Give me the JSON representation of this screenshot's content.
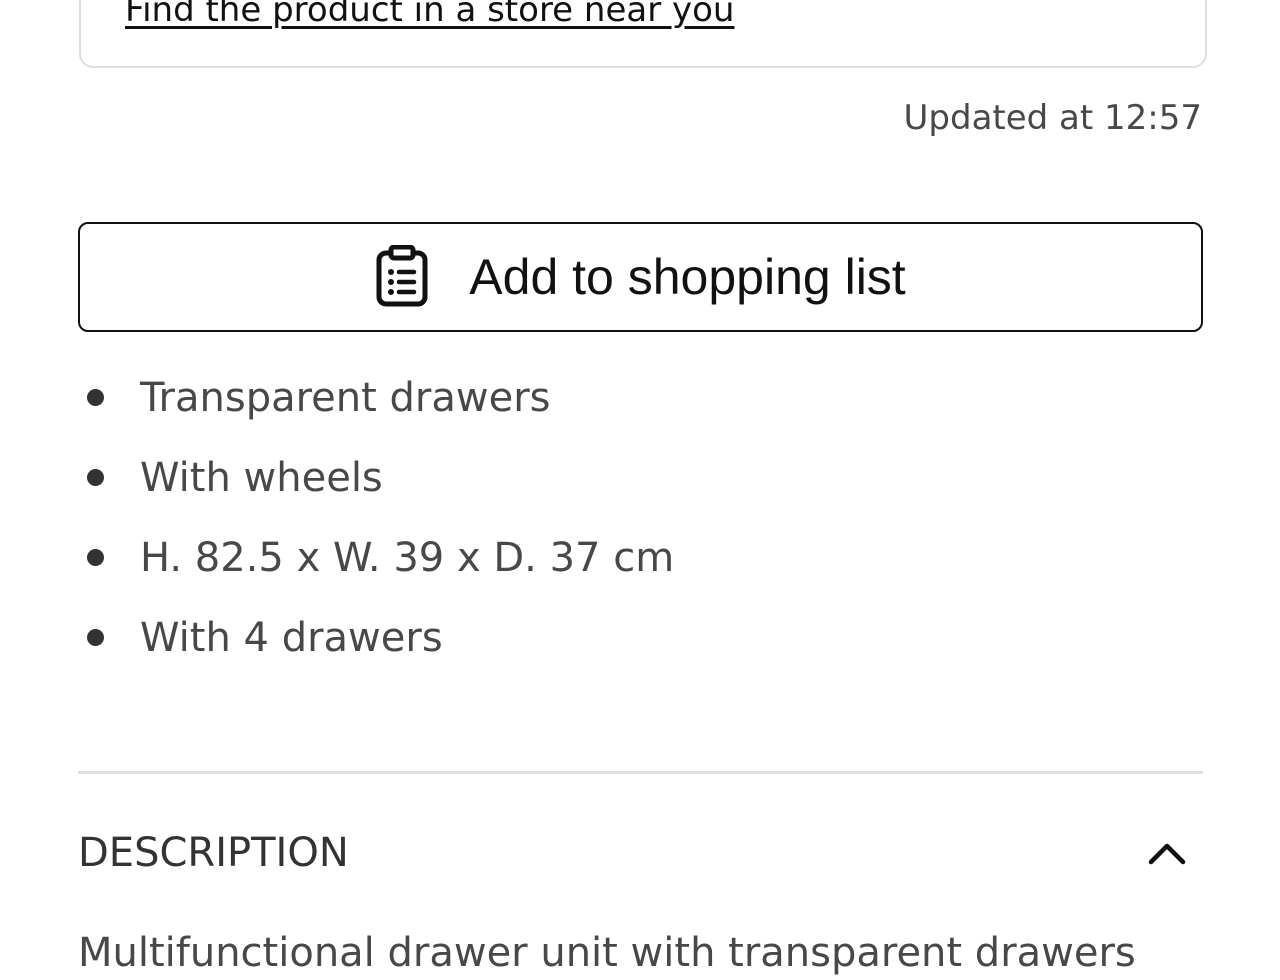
{
  "store_section": {
    "find_link": "Find the product in a store near you",
    "updated_text": "Updated at 12:57"
  },
  "shopping_list_button": {
    "icon": "clipboard-list-icon",
    "label": "Add to shopping list"
  },
  "features": [
    "Transparent drawers",
    "With wheels",
    "H. 82.5 x W. 39 x D. 37 cm",
    "With 4 drawers"
  ],
  "description": {
    "title": "DESCRIPTION",
    "state": "expanded",
    "chevron_icon": "chevron-up-icon",
    "text": "Multifunctional drawer unit with transparent drawers"
  }
}
